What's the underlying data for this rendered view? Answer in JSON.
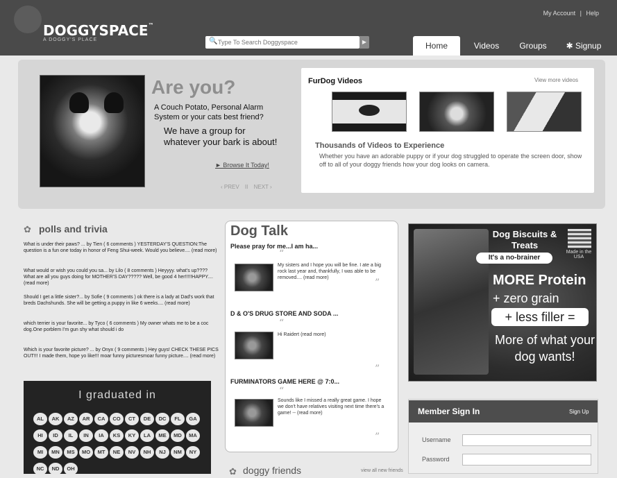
{
  "header": {
    "logo": "DOGGYSPACE",
    "logo_tm": "™",
    "tagline": "A DOGGY'S PLACE",
    "top_links": [
      "My Account",
      "|",
      "Help"
    ],
    "search_placeholder": "Type To Search Doggyspace",
    "search_icon": "search-icon",
    "search_go_icon": "arrow-right-icon",
    "tabs": [
      {
        "label": "Home",
        "active": true
      },
      {
        "label": "Videos"
      },
      {
        "label": "Groups"
      },
      {
        "label": "✱ Signup"
      }
    ]
  },
  "hero": {
    "headline": "Are you?",
    "subtitle": "A Couch Potato, Personal Alarm System or your cats best friend?",
    "group_text": "We have a group for whatever your bark is about!",
    "browse_link": "► Browse It Today!",
    "pager": [
      "‹ PREV",
      "II",
      "NEXT ›"
    ]
  },
  "videos": {
    "title": "FurDog Videos",
    "more_link": "View more videos",
    "headline": "Thousands of Videos to Experience",
    "description": "Whether you have an adorable puppy or if your dog struggled to operate the screen door, show off to all of your doggy friends how your dog looks on camera."
  },
  "polls": {
    "title": "polls and trivia",
    "items": [
      "What is under their paws? ... by Tien ( 6 comments ) YESTERDAY'S QUESTION:The question is a fun one today in honor of Feng Shui-week. Would you believe.... (read more)",
      "What would or wish you could you sa... by Lilo ( 8 comments ) Heyyyy. what's up???? What are all you guys doing for MOTHER'S DAY????? Well, be good 4 her!!!!!HAPPY.... (read more)",
      "Should I get a little sister?... by Sofie ( 9 comments ) ok there is a lady at Dad's work that breds Dachshunds. She will be getting a puppy in like 6 weeks.... (read more)",
      "which terrier is your favorite... by Tyco ( 6 comments ) My owner whats me to be a coc dog.One porblem I'm gun shy what should i do",
      "Which is your favorite picture? ... by Onyx ( 9 comments ) Hey guys! CHECK THESE PICS OUT!!! I made them, hope yo like!!! moar funny picturesmoar funny picture.... (read more)"
    ]
  },
  "graduated": {
    "title": "I graduated in",
    "states": [
      "AL",
      "AK",
      "AZ",
      "AR",
      "CA",
      "CO",
      "CT",
      "DE",
      "DC",
      "FL",
      "GA",
      "HI",
      "ID",
      "IL",
      "IN",
      "IA",
      "KS",
      "KY",
      "LA",
      "ME",
      "MD",
      "MA",
      "MI",
      "MN",
      "MS",
      "MO",
      "MT",
      "NE",
      "NV",
      "NH",
      "NJ",
      "NM",
      "NY",
      "NC",
      "ND",
      "OH"
    ]
  },
  "dog_talk": {
    "title": "Dog Talk",
    "posts": [
      {
        "title": "Please pray for me...I am ha...",
        "quote": "My sisters and I hope you will be fine. I ate a big rock last year and, thankfully, I was able to be removed.... (read more)"
      },
      {
        "title": "D & O'S DRUG STORE AND SODA ...",
        "quote": "Hi Raidert (read more)"
      },
      {
        "title": "FURMINATORS GAME HERE @ 7:0...",
        "quote": "Sounds like I missed a really great game. I hope we don't have relatives visiting next time there's a game! -- (read more)"
      }
    ]
  },
  "friends": {
    "title": "doggy friends",
    "more_link": "view all new friends"
  },
  "ad": {
    "title": "Dog Biscuits & Treats",
    "tag": "It's a no-brainer",
    "usa": "Made in the USA",
    "protein": "MORE Protein",
    "grain": "+ zero grain",
    "filler": "+ less filler =",
    "more": "More of what your dog wants!"
  },
  "signin": {
    "title": "Member Sign In",
    "signup": "Sign Up",
    "username_label": "Username",
    "password_label": "Password"
  }
}
